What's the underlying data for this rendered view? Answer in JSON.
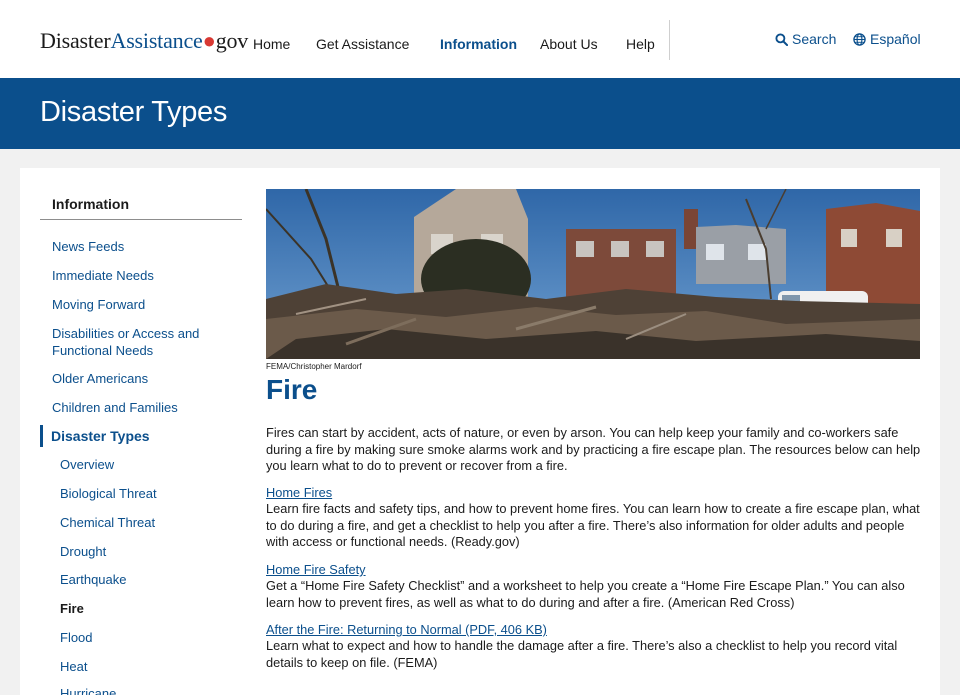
{
  "header": {
    "logo": {
      "part1": "Disaster",
      "part2": "Assistance",
      "dot": "●",
      "part3": "gov"
    },
    "nav": [
      "Home",
      "Get Assistance",
      "Information",
      "About Us",
      "Help"
    ],
    "active_nav": "Information",
    "search_label": "Search",
    "language_label": "Español"
  },
  "banner": {
    "title": "Disaster Types"
  },
  "sidebar": {
    "title": "Information",
    "items": [
      "News Feeds",
      "Immediate Needs",
      "Moving Forward",
      "Disabilities or Access and Functional Needs",
      "Older Americans",
      "Children and Families"
    ],
    "current_section": "Disaster Types",
    "subitems": [
      "Overview",
      "Biological Threat",
      "Chemical Threat",
      "Drought",
      "Earthquake",
      "Fire",
      "Flood",
      "Heat",
      "Hurricane"
    ],
    "current_subitem": "Fire"
  },
  "main": {
    "image_credit": "FEMA/Christopher Mardorf",
    "title": "Fire",
    "intro": "Fires can start by accident, acts of nature, or even by arson. You can help keep your family and co-workers safe during a fire by making sure smoke alarms work and by practicing a fire escape plan. The resources below can help you learn what to do to prevent or recover from a fire.",
    "resources": [
      {
        "link": "Home Fires",
        "text": "Learn fire facts and safety tips, and how to prevent home fires. You can learn how to create a fire escape plan, what to do during a fire, and get a checklist to help you after a fire. There’s also information for older adults and people with access or functional needs. (Ready.gov)"
      },
      {
        "link": "Home Fire Safety",
        "text": "Get a “Home Fire Safety Checklist” and a worksheet to help you create a “Home Fire Escape Plan.” You can also learn how to prevent fires, as well as what to do during and after a fire. (American Red Cross)"
      },
      {
        "link": "After the Fire: Returning to Normal (PDF, 406 KB)",
        "text": "Learn what to expect and how to handle the damage after a fire. There’s also a checklist to help you record vital details to keep on file. (FEMA)"
      }
    ]
  },
  "colors": {
    "brand_blue": "#0b4f8c",
    "accent_red": "#d83933",
    "page_bg": "#f1f1f1"
  },
  "icons": {
    "search": "search-icon",
    "language": "globe-icon"
  }
}
